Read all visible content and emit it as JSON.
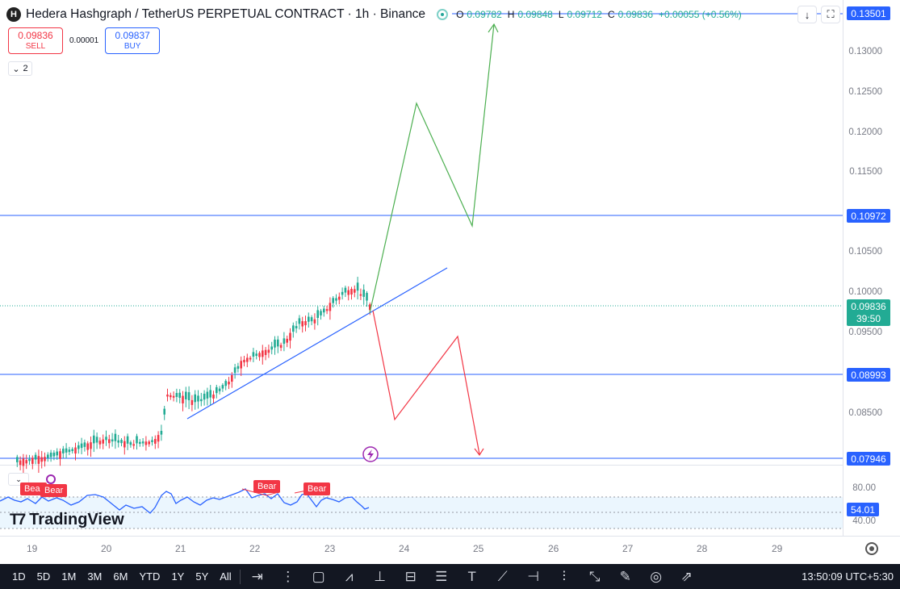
{
  "header": {
    "symbol_icon": "H",
    "title": "Hedera Hashgraph / TetherUS PERPETUAL CONTRACT · 1h · Binance",
    "ohlc": [
      {
        "k": "O",
        "v": "0.09782"
      },
      {
        "k": "H",
        "v": "0.09848"
      },
      {
        "k": "L",
        "v": "0.09712"
      },
      {
        "k": "C",
        "v": "0.09836"
      },
      {
        "k": "",
        "v": "+0.00055 (+0.56%)"
      }
    ]
  },
  "trade": {
    "sell_price": "0.09836",
    "sell_label": "SELL",
    "spread": "0.00001",
    "buy_price": "0.09837",
    "buy_label": "BUY"
  },
  "indicators_count": "2",
  "price_axis": {
    "ticks": [
      "0.13000",
      "0.12500",
      "0.12000",
      "0.11500",
      "0.10500",
      "0.10000",
      "0.09500",
      "0.08500"
    ],
    "levels": [
      "0.13501",
      "0.10972",
      "0.08993",
      "0.07946"
    ],
    "current_price": "0.09836",
    "countdown": "39:50"
  },
  "rsi": {
    "upper": "80.00",
    "lower": "40.00",
    "value": "54.01",
    "signals": [
      "Bear",
      "Bear",
      "Bear",
      "Bear"
    ]
  },
  "brand": "TradingView",
  "time_axis": [
    "19",
    "20",
    "21",
    "22",
    "23",
    "24",
    "25",
    "26",
    "27",
    "28",
    "29"
  ],
  "bottom_bar": {
    "ranges": [
      "1D",
      "5D",
      "1M",
      "3M",
      "6M",
      "YTD",
      "1Y",
      "5Y",
      "All"
    ],
    "clock": "13:50:09 UTC+5:30"
  },
  "colors": {
    "up": "#22ab94",
    "down": "#f23645",
    "level_line": "#2962ff",
    "bullish_path": "#4caf50",
    "bearish_path": "#f23645",
    "rsi_line": "#2962ff"
  }
}
